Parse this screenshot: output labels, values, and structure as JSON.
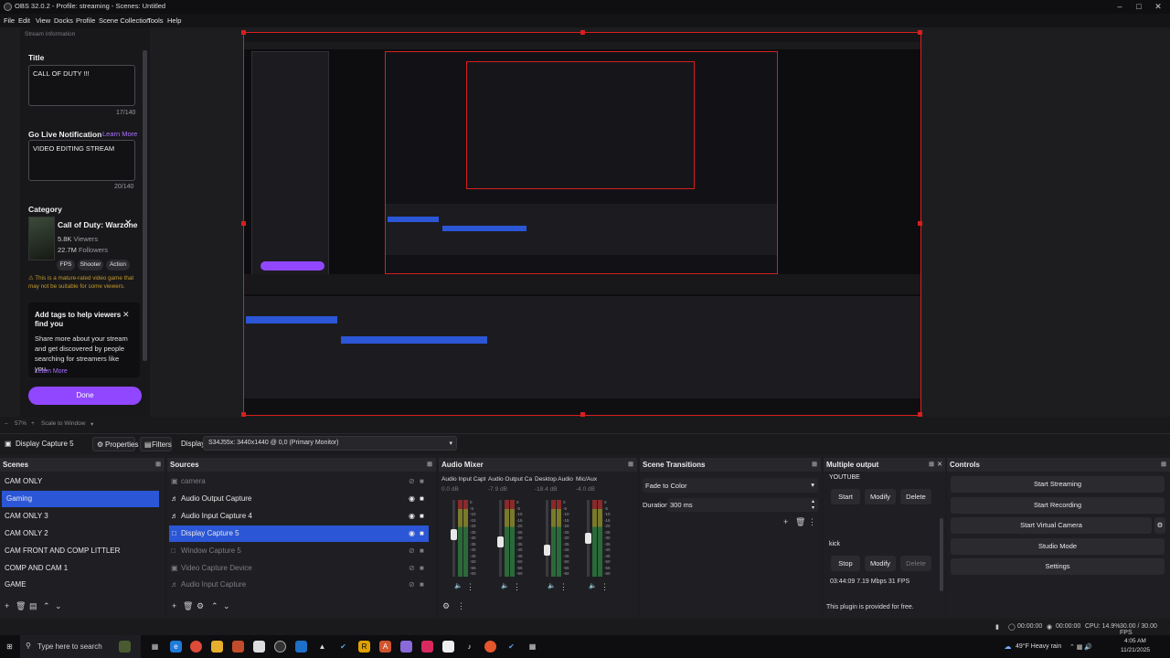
{
  "window": {
    "title": "OBS 32.0.2 - Profile: streaming - Scenes: Untitled"
  },
  "menu": [
    "File",
    "Edit",
    "View",
    "Docks",
    "Profile",
    "Scene Collection",
    "Tools",
    "Help"
  ],
  "stream_info": {
    "header": "Stream Information",
    "title_label": "Title",
    "title_value": "CALL OF DUTY !!!",
    "title_count": "17/140",
    "golive_label": "Go Live Notification",
    "learn_more": "Learn More",
    "golive_value": "VIDEO EDITING STREAM",
    "golive_count": "20/140",
    "category_label": "Category",
    "game_name": "Call of Duty: Warzone",
    "viewers": "5.8K",
    "viewers_label": "Viewers",
    "followers": "22.7M",
    "followers_label": "Followers",
    "tags": [
      "FPS",
      "Shooter",
      "Action"
    ],
    "warning": "This is a mature-rated video game that may not be suitable for some viewers.",
    "tags_title": "Add tags to help viewers find you",
    "tags_body": "Share more about your stream and get discovered by people searching for streamers like you.",
    "tags_learn": "Learn More",
    "done": "Done"
  },
  "preview": {
    "zoom": "57%",
    "scale_mode": "Scale to Window"
  },
  "source_toolbar": {
    "source_name": "Display Capture 5",
    "properties": "Properties",
    "filters": "Filters",
    "display_label": "Display",
    "display_value": "S34J55x: 3440x1440 @ 0,0 (Primary Monitor)"
  },
  "scenes": {
    "title": "Scenes",
    "items": [
      "CAM ONLY",
      "Gaming",
      "CAM ONLY 3",
      "CAM ONLY 2",
      "CAM FRONT AND COMP LITTLER",
      "COMP AND CAM 1",
      "GAME"
    ],
    "selected": 1
  },
  "sources": {
    "title": "Sources",
    "items": [
      {
        "name": "camera",
        "dim": true
      },
      {
        "name": "Audio Output Capture",
        "dim": false
      },
      {
        "name": "Audio Input Capture 4",
        "dim": false
      },
      {
        "name": "Display Capture 5",
        "dim": false,
        "selected": true
      },
      {
        "name": "Window Capture 5",
        "dim": true
      },
      {
        "name": "Video Capture Device",
        "dim": true
      },
      {
        "name": "Audio Input Capture",
        "dim": true
      }
    ]
  },
  "mixer": {
    "title": "Audio Mixer",
    "channels": [
      {
        "name": "Audio Input Captur",
        "db": "0.0 dB",
        "level": 0.55
      },
      {
        "name": "Audio Output Capt",
        "db": "-7.9 dB",
        "level": 0.45
      },
      {
        "name": "Desktop Audio",
        "db": "-18.4 dB",
        "level": 0.35
      },
      {
        "name": "Mic/Aux",
        "db": "-4.0 dB",
        "level": 0.5
      }
    ],
    "scale": [
      "0",
      "-5",
      "-10",
      "-15",
      "-20",
      "-25",
      "-30",
      "-35",
      "-40",
      "-45",
      "-50",
      "-55",
      "-60"
    ]
  },
  "transitions": {
    "title": "Scene Transitions",
    "transition": "Fade to Color",
    "duration_label": "Duration",
    "duration_value": "300 ms"
  },
  "multi_output": {
    "title": "Multiple output",
    "target1": "YOUTUBE",
    "start": "Start",
    "modify": "Modify",
    "delete": "Delete",
    "target2": "kick",
    "stop": "Stop",
    "stats": "03:44:09 7.19 Mbps 31 FPS",
    "plugin_note": "This plugin is provided for free."
  },
  "controls": {
    "title": "Controls",
    "buttons": [
      "Start Streaming",
      "Start Recording",
      "Start Virtual Camera",
      "Studio Mode",
      "Settings"
    ]
  },
  "status": {
    "stream_time": "00:00:00",
    "rec_time": "00:00:00",
    "cpu": "CPU: 14.9%",
    "fps": "30.00 / 30.00 FPS"
  },
  "taskbar": {
    "search_placeholder": "Type here to search",
    "weather": "49°F  Heavy rain",
    "time": "4:05 AM",
    "date": "11/21/2025"
  },
  "colors": {
    "accent": "#2b56d6",
    "twitch": "#9147ff",
    "recording_border": "#d61f1f"
  }
}
